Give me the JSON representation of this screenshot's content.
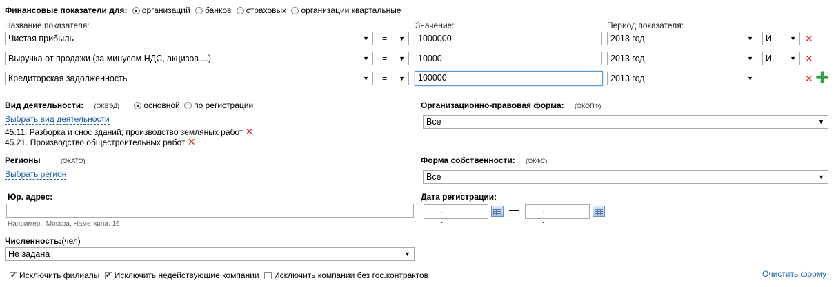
{
  "header": {
    "title": "Финансовые показатели для:",
    "options": [
      "организаций",
      "банков",
      "страховых",
      "организаций квартальные"
    ],
    "selected_index": 0
  },
  "indicators": {
    "col_name": "Название показателя:",
    "col_value": "Значение:",
    "col_period": "Период показателя:",
    "rows": [
      {
        "name": "Чистая прибыль",
        "op": "=",
        "value": "1000000",
        "period": "2013 год",
        "logic": "И"
      },
      {
        "name": "Выручка от продажи (за минусом НДС, акцизов ...)",
        "op": "=",
        "value": "10000",
        "period": "2013 год",
        "logic": "И"
      },
      {
        "name": "Кредиторская задолженность",
        "op": "=",
        "value": "100000",
        "period": "2013 год",
        "logic": ""
      }
    ]
  },
  "activity": {
    "title": "Вид деятельности:",
    "code": "(ОКВЭД)",
    "opt_main": "основной",
    "opt_reg": "по регистрации",
    "select_link": "Выбрать вид деятельности",
    "items": [
      "45.11. Разборка и снос зданий; производство земляных работ",
      "45.21. Производство общестроительных работ"
    ]
  },
  "legal_form": {
    "title": "Организационно-правовая форма:",
    "code": "(ОКОПФ)",
    "value": "Все"
  },
  "regions": {
    "title": "Регионы",
    "code": "(ОКАТО)",
    "select_link": "Выбрать регион"
  },
  "ownership": {
    "title": "Форма собственности:",
    "code": "(ОКФС)",
    "value": "Все"
  },
  "address": {
    "title": "Юр. адрес:",
    "value": "",
    "hint_label": "Например,",
    "hint_value": "Москва, Наметкина, 16"
  },
  "reg_date": {
    "title": "Дата регистрации:",
    "from_mask": ". .",
    "to_mask": ". .",
    "dash": "—"
  },
  "employees": {
    "title": "Численность:",
    "unit": "(чел)",
    "value": "Не задана"
  },
  "footer": {
    "exclude_branches": "Исключить филиалы",
    "exclude_inactive": "Исключить недействующие компании",
    "exclude_no_contracts": "Исключить компании без гос.контрактов",
    "clear_form": "Очистить форму"
  }
}
